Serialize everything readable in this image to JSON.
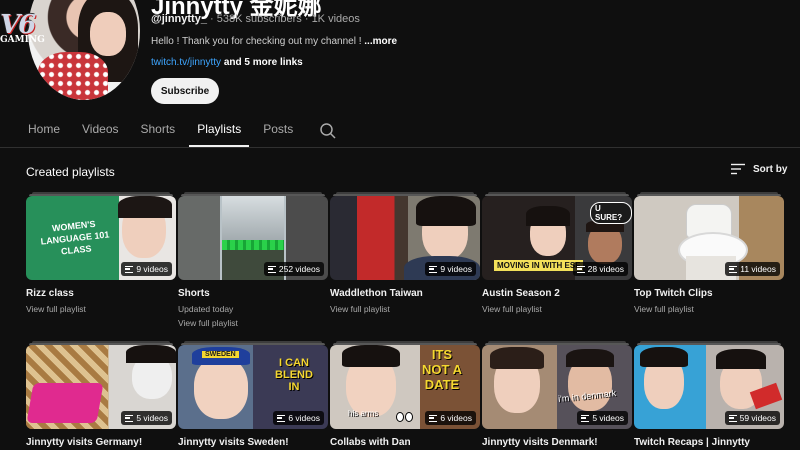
{
  "channel": {
    "name": "Jinnytty 金妮娜",
    "handle": "@jinnytty_",
    "subscribers": "538K subscribers",
    "videos": "1K videos",
    "separator": "·",
    "description": "Hello ! Thank you for checking out my channel !",
    "more_label": "...more",
    "link_url": "twitch.tv/jinnytty",
    "more_links": "and 5 more links",
    "subscribe_label": "Subscribe",
    "watermark": "V6",
    "watermark_sub": "GAMING"
  },
  "tabs": [
    {
      "label": "Home",
      "active": false
    },
    {
      "label": "Videos",
      "active": false
    },
    {
      "label": "Shorts",
      "active": false
    },
    {
      "label": "Playlists",
      "active": true
    },
    {
      "label": "Posts",
      "active": false
    }
  ],
  "section": {
    "title": "Created playlists",
    "sort_label": "Sort by"
  },
  "playlists": [
    {
      "title": "Rizz class",
      "line1": "View full playlist",
      "line2": "",
      "count": "9 videos",
      "caption": "WOMEN'S LANGUAGE 101 CLASS"
    },
    {
      "title": "Shorts",
      "line1": "Updated today",
      "line2": "View full playlist",
      "count": "252 videos",
      "caption": ""
    },
    {
      "title": "Waddlethon Taiwan",
      "line1": "View full playlist",
      "line2": "",
      "count": "9 videos",
      "caption": ""
    },
    {
      "title": "Austin Season 2",
      "line1": "View full playlist",
      "line2": "",
      "count": "28 videos",
      "caption": "MOVING IN WITH ESF",
      "caption2": "U SURE?"
    },
    {
      "title": "Top Twitch Clips",
      "line1": "View full playlist",
      "line2": "",
      "count": "11 videos",
      "caption": ""
    },
    {
      "title": "Jinnytty visits Germany!",
      "line1": "",
      "line2": "",
      "count": "5 videos",
      "caption": ""
    },
    {
      "title": "Jinnytty visits Sweden!",
      "line1": "",
      "line2": "",
      "count": "6 videos",
      "caption": "I CAN BLEND IN",
      "caption2": "SWEDEN"
    },
    {
      "title": "Collabs with Dan",
      "line1": "",
      "line2": "",
      "count": "6 videos",
      "caption": "ITS NOT A DATE",
      "caption2": "his arms"
    },
    {
      "title": "Jinnytty visits Denmark!",
      "line1": "",
      "line2": "",
      "count": "5 videos",
      "caption": "i'm in denmark"
    },
    {
      "title": "Twitch Recaps | Jinnytty",
      "line1": "",
      "line2": "",
      "count": "59 videos",
      "caption": ""
    }
  ],
  "colors": {
    "background": "#0f0f0f",
    "text": "#f1f1f1",
    "muted": "#aaaaaa",
    "link": "#3ea6ff"
  }
}
